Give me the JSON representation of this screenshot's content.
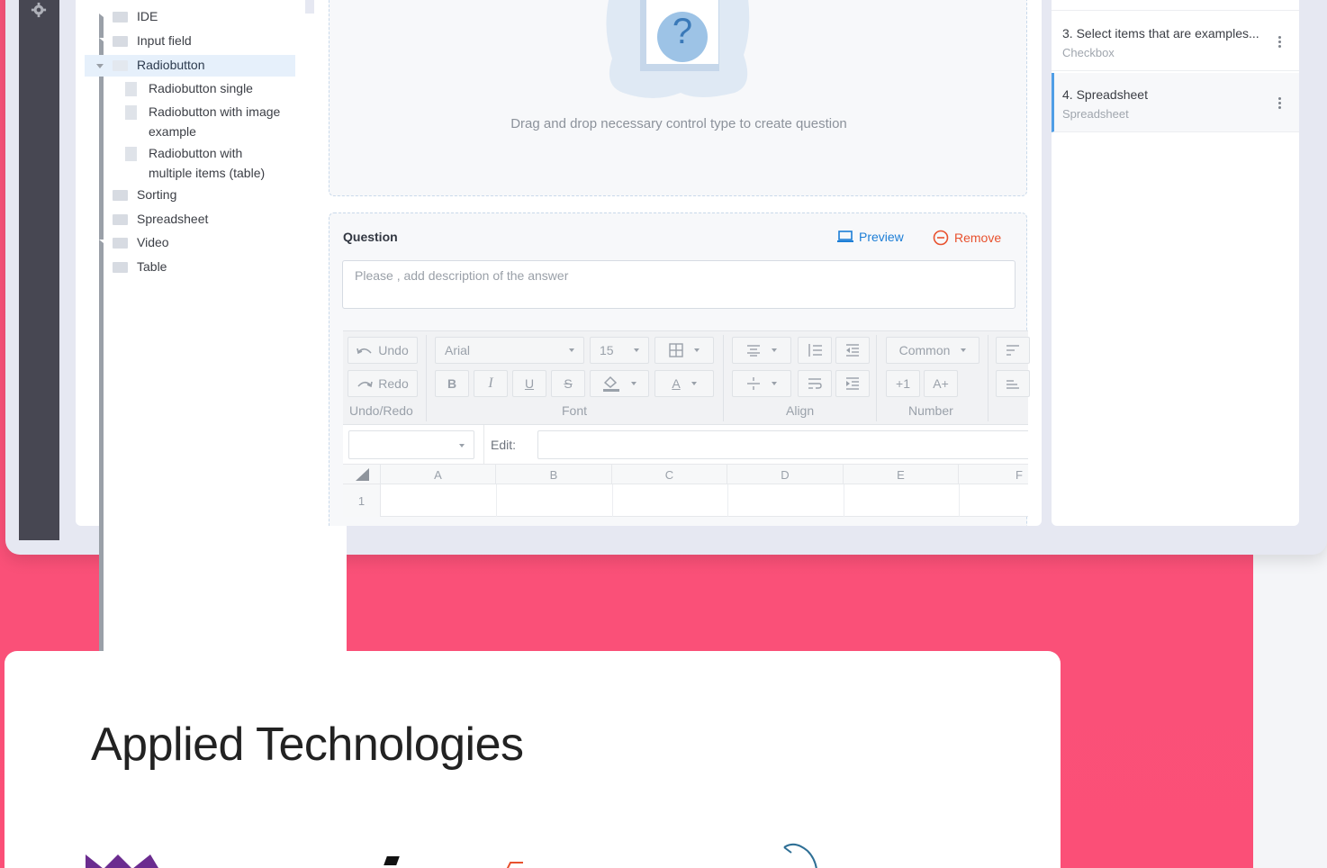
{
  "tree": {
    "items": [
      {
        "label": "IDE"
      },
      {
        "label": "Input field"
      },
      {
        "label": "Radiobutton"
      },
      {
        "label": "Radiobutton single"
      },
      {
        "label": "Radiobutton with image\nexample"
      },
      {
        "label": "Radiobutton with\nmultiple items (table)"
      },
      {
        "label": "Sorting"
      },
      {
        "label": "Spreadsheet"
      },
      {
        "label": "Video"
      },
      {
        "label": "Table"
      }
    ]
  },
  "dropzone": {
    "text": "Drag and drop necessary control type to create question",
    "icon": "?"
  },
  "question": {
    "title": "Question",
    "preview_label": "Preview",
    "remove_label": "Remove",
    "description_placeholder": "Please , add description of the answer"
  },
  "ribbon": {
    "undo": "Undo",
    "redo": "Redo",
    "undo_group": "Undo/Redo",
    "font_family": "Arial",
    "font_size": "15",
    "bold": "B",
    "italic": "I",
    "underline": "U",
    "strike": "S",
    "font_color": "A",
    "font_group": "Font",
    "align_group": "Align",
    "number_format": "Common",
    "inc_decimal": "+1",
    "inc_size": "A+",
    "number_group": "Number",
    "edit_label": "Edit:"
  },
  "sheet": {
    "columns": [
      "A",
      "B",
      "C",
      "D",
      "E",
      "F"
    ],
    "rows": [
      "1"
    ]
  },
  "questions_list": [
    {
      "title": "3. Select items that are examples...",
      "type": "Checkbox"
    },
    {
      "title": "4. Spreadsheet",
      "type": "Spreadsheet"
    }
  ],
  "section": {
    "heading": "Applied Technologies"
  },
  "colors": {
    "pink": "#fb4f77",
    "accent": "#1c7ed6",
    "danger": "#e8512e",
    "selected": "#e6f0fb"
  }
}
